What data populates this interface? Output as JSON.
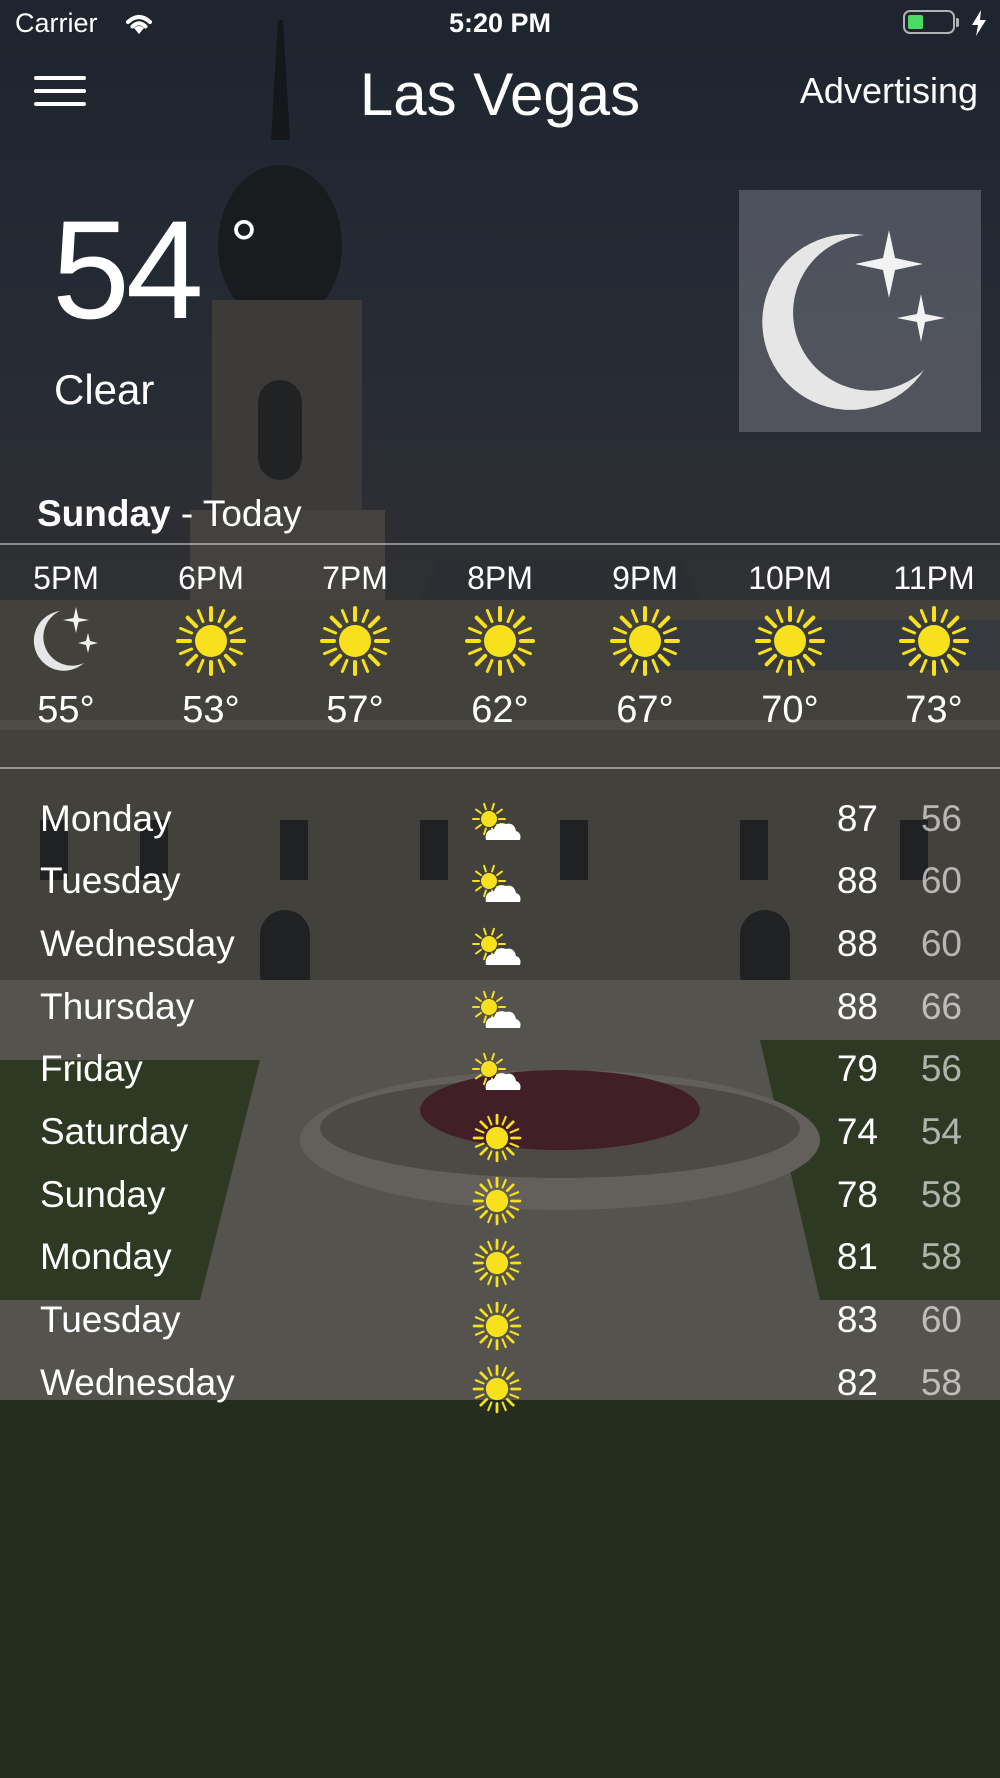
{
  "status_bar": {
    "carrier": "Carrier",
    "time": "5:20 PM",
    "battery_color": "#4cd964"
  },
  "nav": {
    "menu_icon": "hamburger-menu-icon",
    "city": "Las Vegas",
    "advertising": "Advertising"
  },
  "current": {
    "temperature": "54",
    "degree_symbol": "°",
    "condition": "Clear",
    "icon": "moon-stars-icon"
  },
  "today": {
    "day": "Sunday",
    "suffix": " - Today"
  },
  "hourly": [
    {
      "time": "5PM",
      "icon": "moon-stars-icon",
      "temp": "55°"
    },
    {
      "time": "6PM",
      "icon": "sun-icon",
      "temp": "53°"
    },
    {
      "time": "7PM",
      "icon": "sun-icon",
      "temp": "57°"
    },
    {
      "time": "8PM",
      "icon": "sun-icon",
      "temp": "62°"
    },
    {
      "time": "9PM",
      "icon": "sun-icon",
      "temp": "67°"
    },
    {
      "time": "10PM",
      "icon": "sun-icon",
      "temp": "70°"
    },
    {
      "time": "11PM",
      "icon": "sun-icon",
      "temp": "73°"
    }
  ],
  "daily": [
    {
      "day": "Monday",
      "icon": "partly-cloudy-icon",
      "high": "87",
      "low": "56"
    },
    {
      "day": "Tuesday",
      "icon": "partly-cloudy-icon",
      "high": "88",
      "low": "60"
    },
    {
      "day": "Wednesday",
      "icon": "partly-cloudy-icon",
      "high": "88",
      "low": "60"
    },
    {
      "day": "Thursday",
      "icon": "partly-cloudy-icon",
      "high": "88",
      "low": "66"
    },
    {
      "day": "Friday",
      "icon": "partly-cloudy-icon",
      "high": "79",
      "low": "56"
    },
    {
      "day": "Saturday",
      "icon": "sun-icon",
      "high": "74",
      "low": "54"
    },
    {
      "day": "Sunday",
      "icon": "sun-icon",
      "high": "78",
      "low": "58"
    },
    {
      "day": "Monday",
      "icon": "sun-icon",
      "high": "81",
      "low": "58"
    },
    {
      "day": "Tuesday",
      "icon": "sun-icon",
      "high": "83",
      "low": "60"
    },
    {
      "day": "Wednesday",
      "icon": "sun-icon",
      "high": "82",
      "low": "58"
    }
  ],
  "colors": {
    "sun": "#f7e01c",
    "moon": "#e6e6e6",
    "cloud": "#ffffff"
  }
}
